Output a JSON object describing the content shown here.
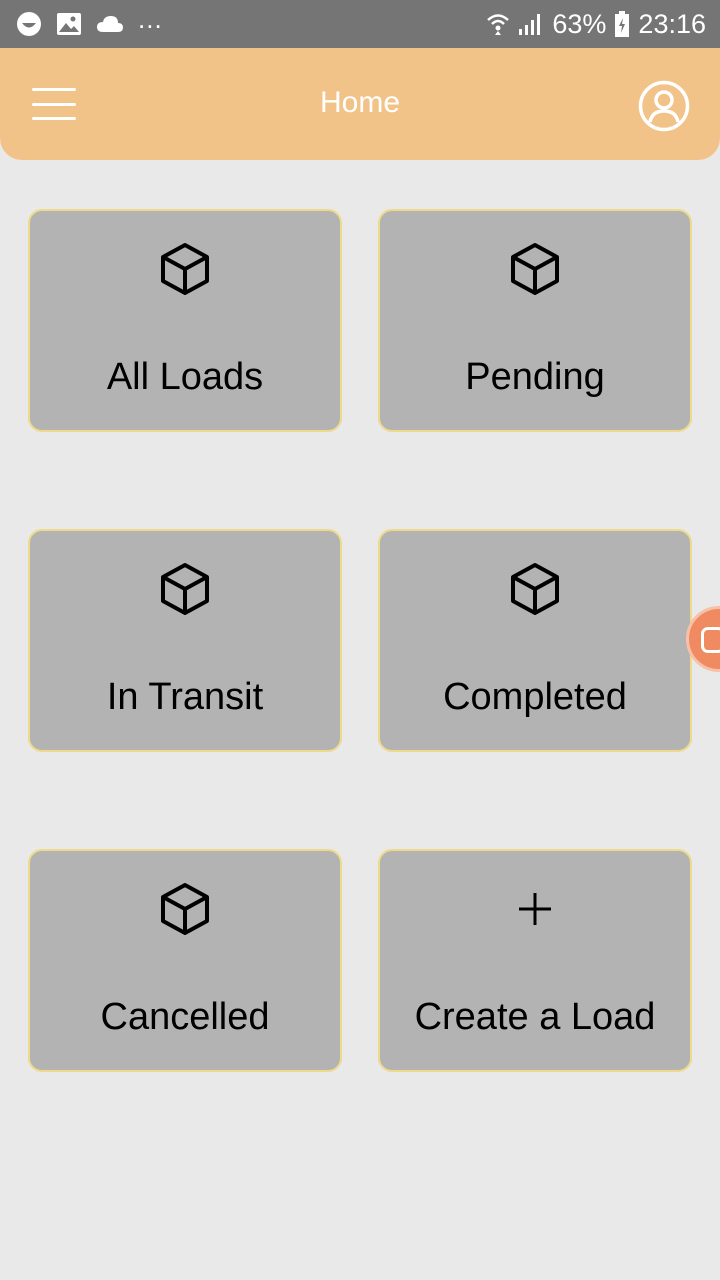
{
  "status_bar": {
    "dots": "...",
    "battery": "63%",
    "time": "23:16",
    "icons": [
      "smiley-icon",
      "image-icon",
      "cloud-icon",
      "wifi-icon",
      "signal-icon",
      "battery-icon"
    ]
  },
  "app_bar": {
    "title": "Home",
    "background": "#f2c389",
    "icons": [
      "menu-icon",
      "profile-icon"
    ]
  },
  "tiles": [
    {
      "label": "All Loads",
      "icon": "box-icon"
    },
    {
      "label": "Pending",
      "icon": "box-icon"
    },
    {
      "label": "In Transit",
      "icon": "box-icon"
    },
    {
      "label": "Completed",
      "icon": "box-icon"
    },
    {
      "label": "Cancelled",
      "icon": "box-icon"
    },
    {
      "label": "Create a Load",
      "icon": "plus-icon"
    }
  ],
  "colors": {
    "tile_background": "#b3b3b3",
    "tile_border": "#efd98a",
    "page_background": "#e9e9e9",
    "floating_button": "#f08a60"
  }
}
